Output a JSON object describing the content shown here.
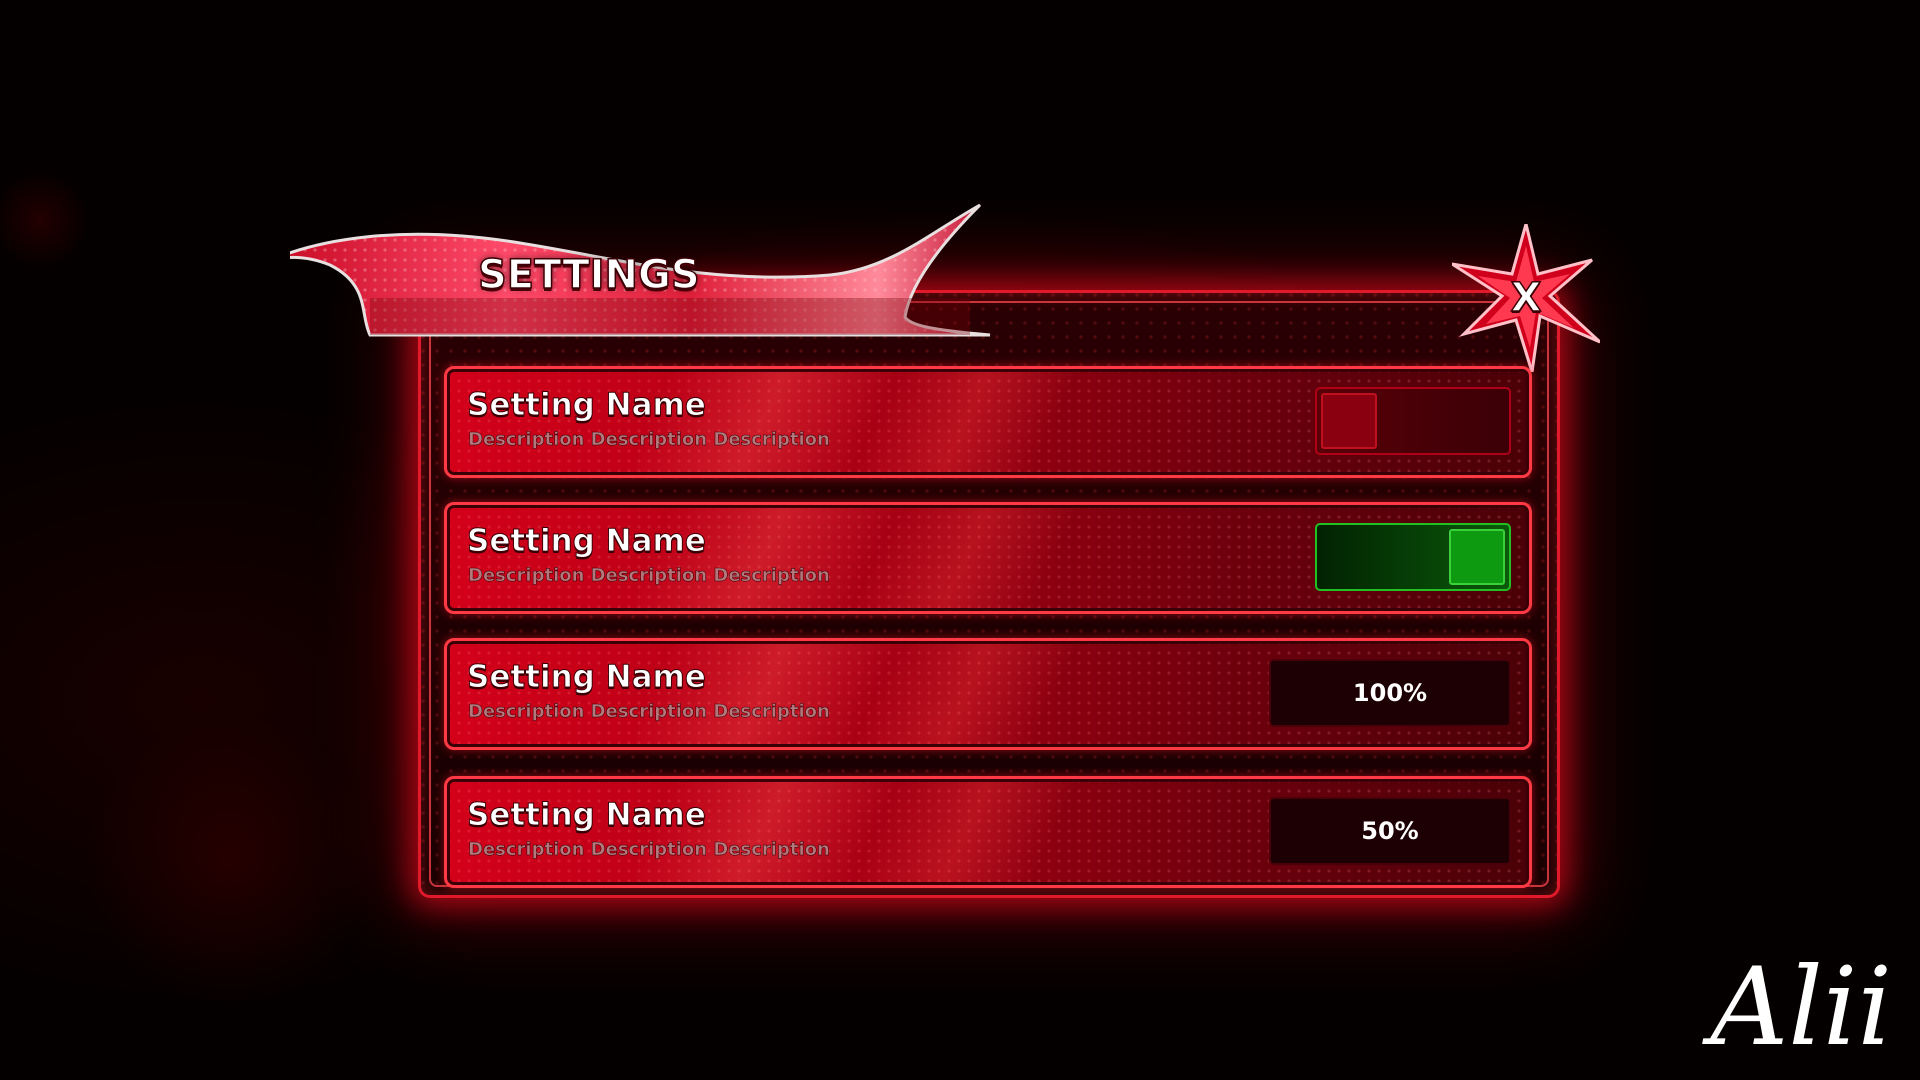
{
  "window": {
    "title": "SETTINGS",
    "close_label": "X"
  },
  "settings": [
    {
      "name": "Setting Name",
      "description": "Description Description Description",
      "control": "toggle",
      "state": "off"
    },
    {
      "name": "Setting Name",
      "description": "Description Description Description",
      "control": "toggle",
      "state": "on"
    },
    {
      "name": "Setting Name",
      "description": "Description Description Description",
      "control": "value",
      "value": "100%"
    },
    {
      "name": "Setting Name",
      "description": "Description Description Description",
      "control": "value",
      "value": "50%"
    }
  ],
  "signature": "Alii",
  "colors": {
    "accent": "#e01a2a",
    "toggle_on": "#0e9a10",
    "toggle_off": "#8a0010"
  }
}
